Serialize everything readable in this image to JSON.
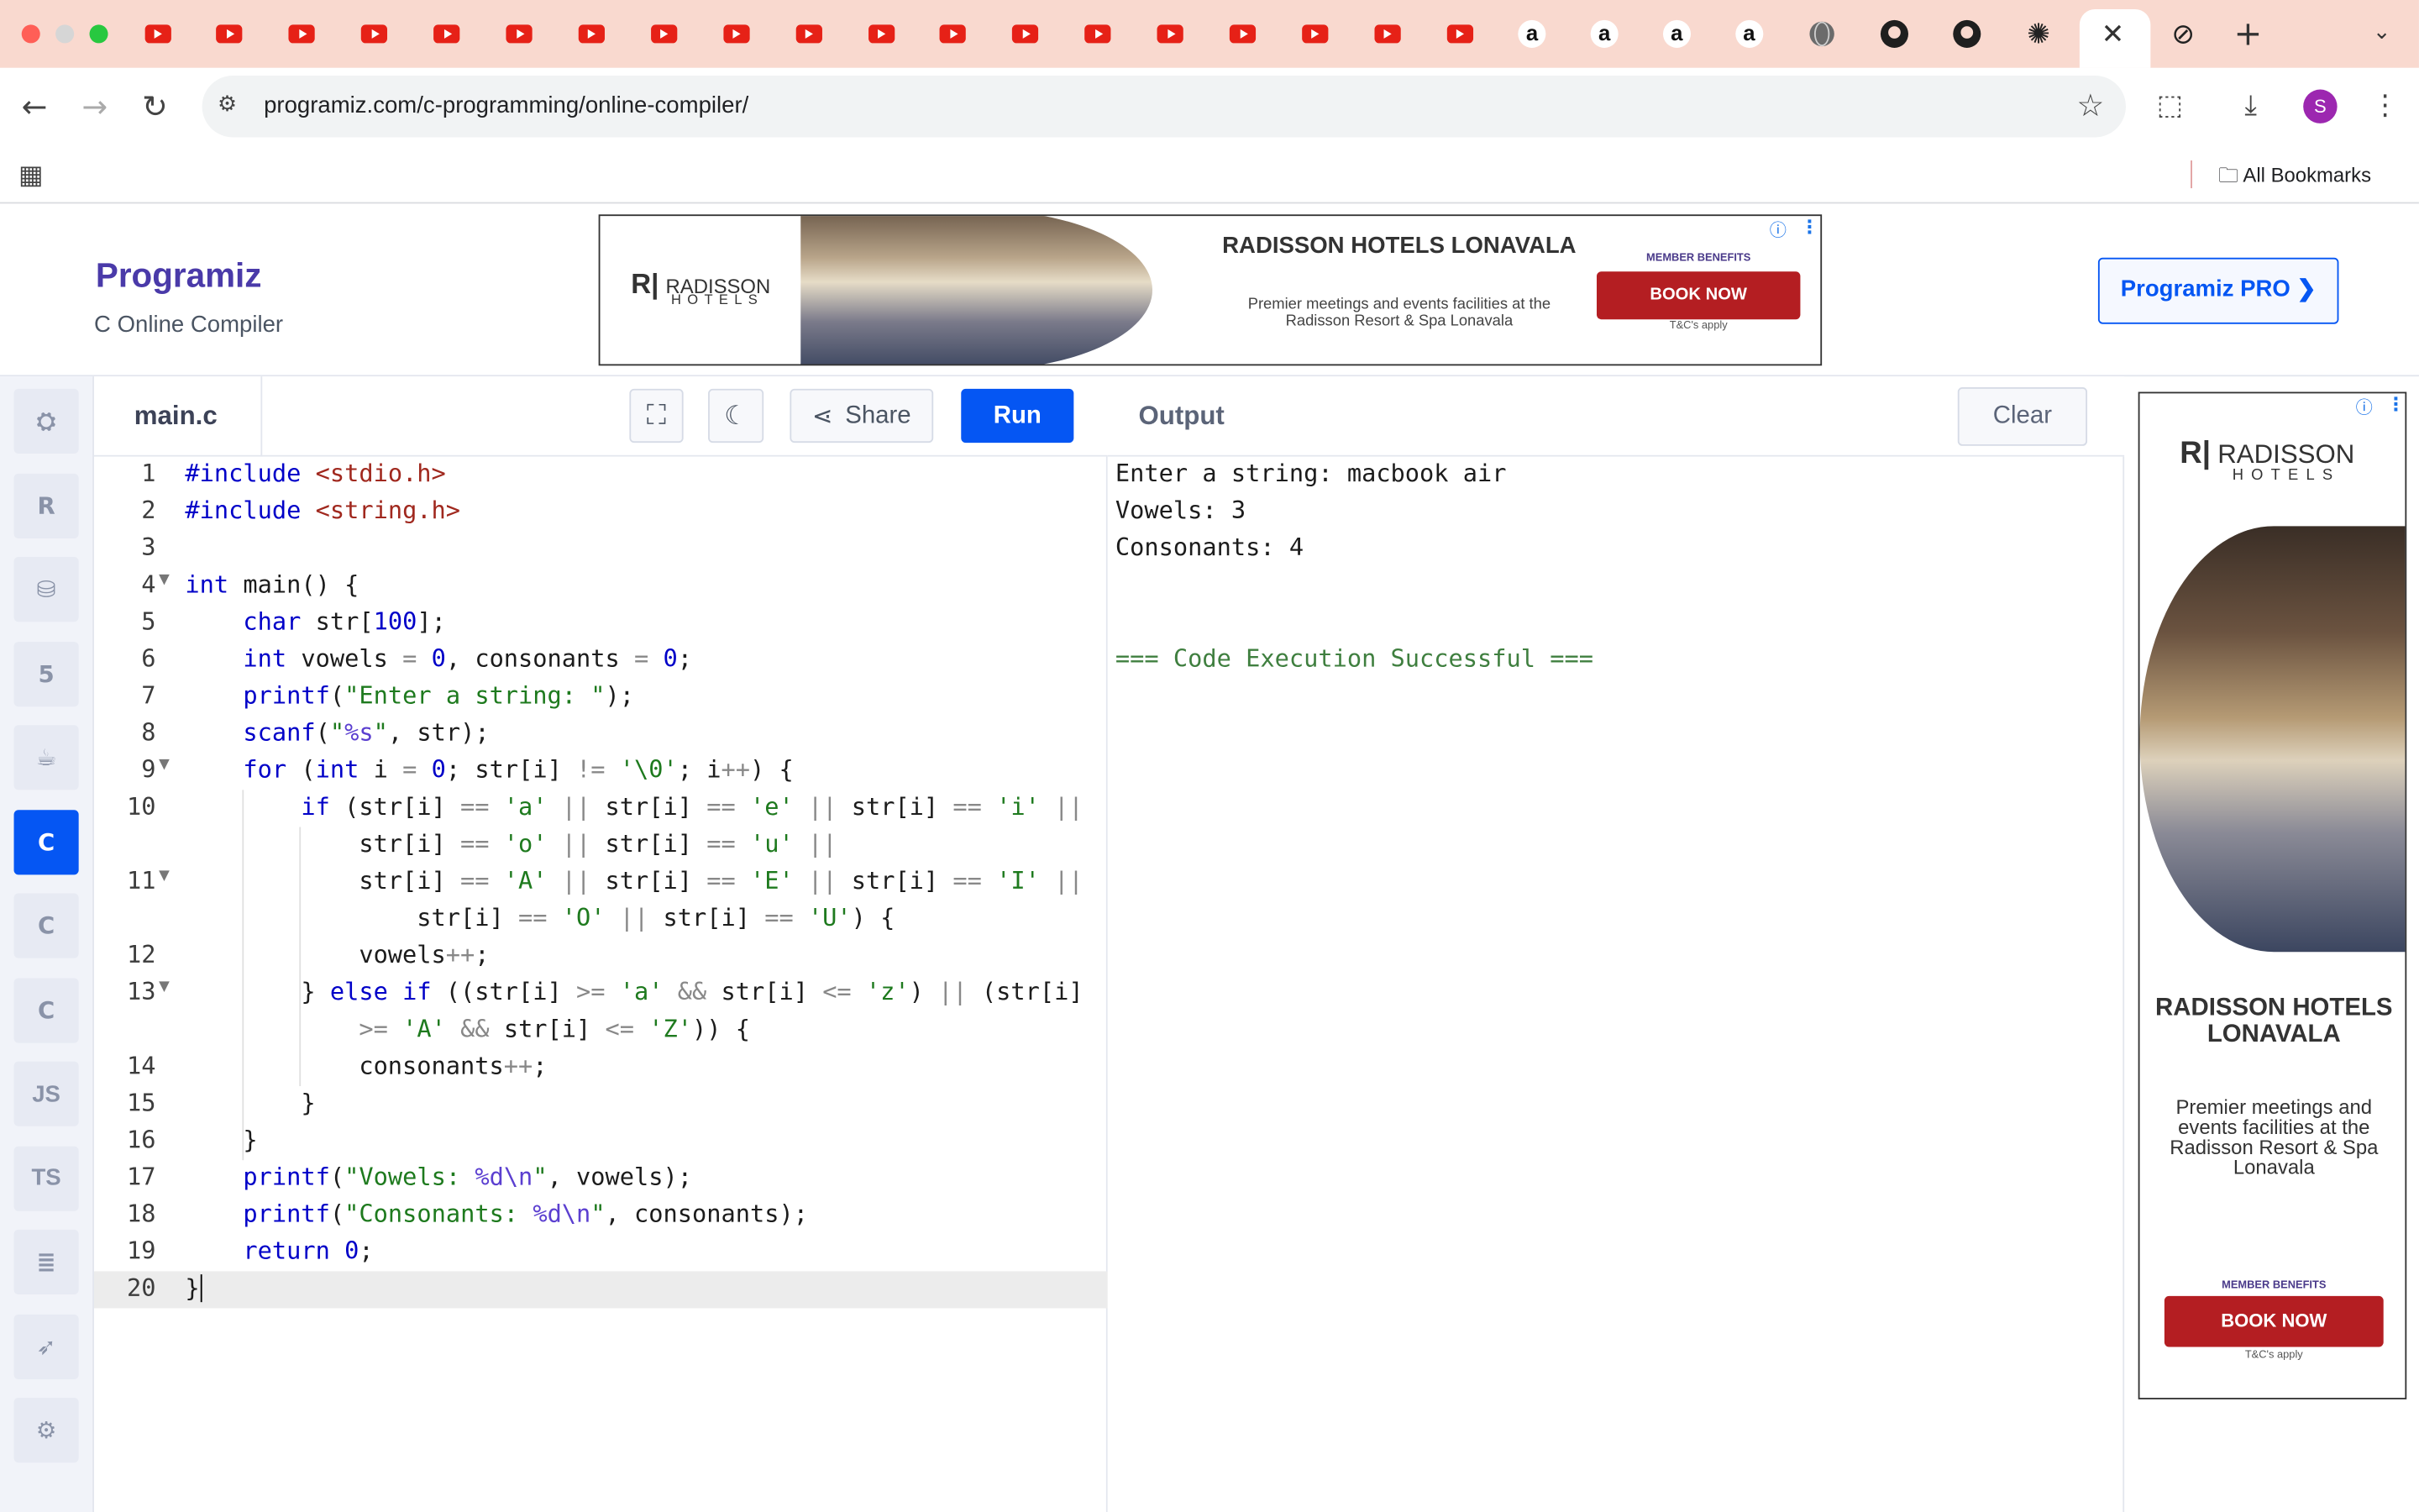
{
  "browser": {
    "url": "programiz.com/c-programming/online-compiler/",
    "bookmarks_label": "All Bookmarks",
    "profile_initial": "S",
    "tabs": [
      {
        "icon": "youtube-icon"
      },
      {
        "icon": "youtube-icon"
      },
      {
        "icon": "youtube-icon"
      },
      {
        "icon": "youtube-icon"
      },
      {
        "icon": "youtube-icon"
      },
      {
        "icon": "youtube-icon"
      },
      {
        "icon": "youtube-icon"
      },
      {
        "icon": "youtube-icon"
      },
      {
        "icon": "youtube-icon"
      },
      {
        "icon": "youtube-icon"
      },
      {
        "icon": "youtube-icon"
      },
      {
        "icon": "youtube-icon"
      },
      {
        "icon": "youtube-icon"
      },
      {
        "icon": "youtube-icon"
      },
      {
        "icon": "youtube-icon"
      },
      {
        "icon": "youtube-icon"
      },
      {
        "icon": "youtube-icon"
      },
      {
        "icon": "youtube-icon"
      },
      {
        "icon": "youtube-icon"
      },
      {
        "icon": "amazon-icon",
        "glyph": "a"
      },
      {
        "icon": "amazon-icon",
        "glyph": "a"
      },
      {
        "icon": "amazon-icon",
        "glyph": "a"
      },
      {
        "icon": "amazon-icon",
        "glyph": "a"
      },
      {
        "icon": "globe-icon"
      },
      {
        "icon": "github-icon"
      },
      {
        "icon": "github-icon"
      },
      {
        "icon": "chatgpt-icon"
      },
      {
        "icon": "programiz-icon",
        "active": true
      },
      {
        "icon": "unknown-site-icon"
      }
    ],
    "colors": {
      "tabstrip": "#f9d9cf",
      "youtube": "#e62117"
    }
  },
  "header": {
    "logo_text": "Programiz",
    "subtitle": "C Online Compiler",
    "pro_button": "Programiz PRO ❯"
  },
  "ad_top": {
    "brand": "RADISSON",
    "brand_sub": "HOTELS",
    "title": "RADISSON HOTELS LONAVALA",
    "description": "Premier meetings and events facilities at the Radisson Resort & Spa Lonavala",
    "member": "MEMBER BENEFITS",
    "cta": "BOOK NOW",
    "terms": "T&C's apply"
  },
  "ad_right": {
    "brand": "RADISSON",
    "brand_sub": "HOTELS",
    "title": "RADISSON HOTELS LONAVALA",
    "description": "Premier meetings and events facilities at the Radisson Resort & Spa Lonavala",
    "member": "MEMBER BENEFITS",
    "cta": "BOOK NOW",
    "terms": "T&C's apply"
  },
  "sidebar": {
    "languages": [
      {
        "name": "python-icon"
      },
      {
        "name": "r-icon"
      },
      {
        "name": "sql-icon"
      },
      {
        "name": "html5-icon"
      },
      {
        "name": "java-icon"
      },
      {
        "name": "c-icon",
        "active": true
      },
      {
        "name": "cpp-icon"
      },
      {
        "name": "csharp-icon"
      },
      {
        "name": "javascript-icon",
        "label": "JS"
      },
      {
        "name": "typescript-icon",
        "label": "TS"
      },
      {
        "name": "go-icon"
      },
      {
        "name": "swift-icon"
      },
      {
        "name": "rust-icon"
      }
    ]
  },
  "editor": {
    "filename": "main.c",
    "share_label": "Share",
    "run_label": "Run",
    "current_line": 20
  },
  "output": {
    "title": "Output",
    "clear_label": "Clear",
    "lines": [
      "Enter a string: macbook air",
      "Vowels: 3",
      "Consonants: 4",
      "",
      "",
      "=== Code Execution Successful ==="
    ]
  }
}
